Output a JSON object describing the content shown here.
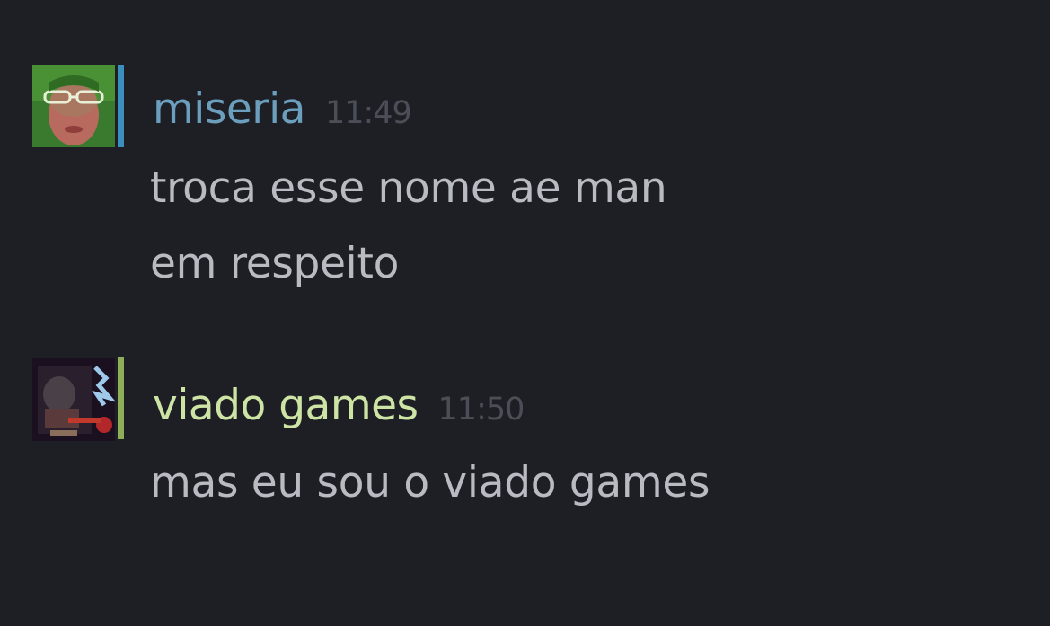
{
  "messages": [
    {
      "username": "miseria",
      "time": "11:49",
      "lines": [
        "troca esse nome ae man",
        "em respeito"
      ],
      "name_color": "#6c9fbe",
      "status_color": "#3a8fbf"
    },
    {
      "username": "viado games",
      "time": "11:50",
      "lines": [
        "mas eu sou o viado games"
      ],
      "name_color": "#cde4a5",
      "status_color": "#8fae5a"
    }
  ]
}
